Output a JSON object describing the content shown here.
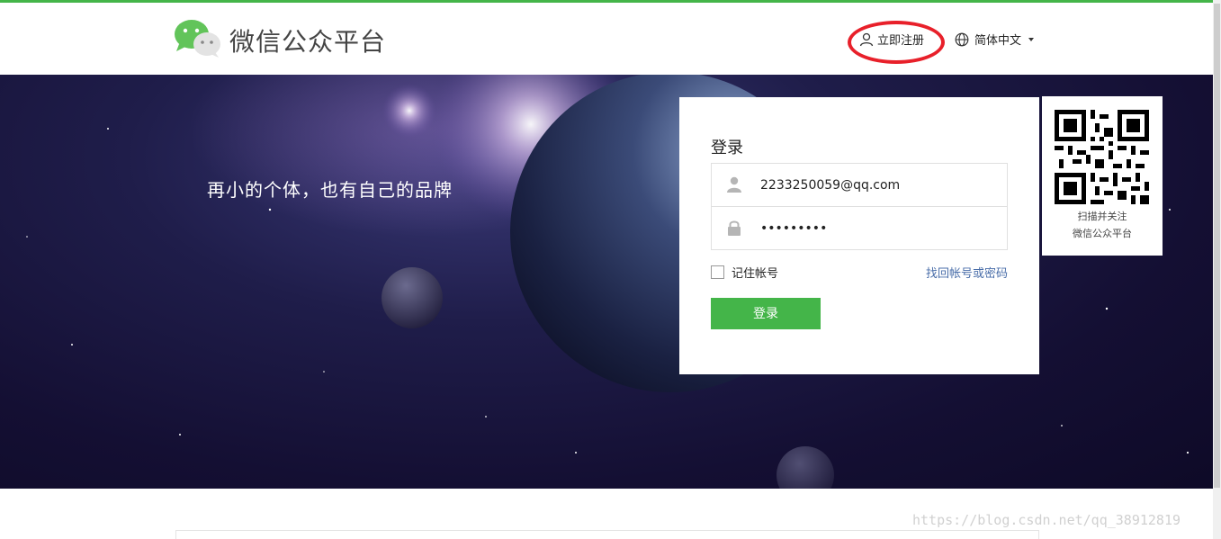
{
  "header": {
    "brand_title": "微信公众平台",
    "register_label": "立即注册",
    "language_label": "简体中文"
  },
  "banner": {
    "slogan": "再小的个体，也有自己的品牌"
  },
  "login": {
    "title": "登录",
    "account_value": "2233250059@qq.com",
    "password_value": "•••••••••",
    "remember_label": "记住帐号",
    "forgot_label": "找回帐号或密码",
    "submit_label": "登录"
  },
  "qr": {
    "line1": "扫描并关注",
    "line2": "微信公众平台"
  },
  "watermark": "https://blog.csdn.net/qq_38912819",
  "colors": {
    "brand_green": "#44b549",
    "annotation_red": "#e8202a",
    "link_blue": "#4a6ea9"
  },
  "icons": [
    "wechat-logo-icon",
    "user-icon",
    "globe-icon",
    "lock-icon",
    "qr-code-icon"
  ]
}
